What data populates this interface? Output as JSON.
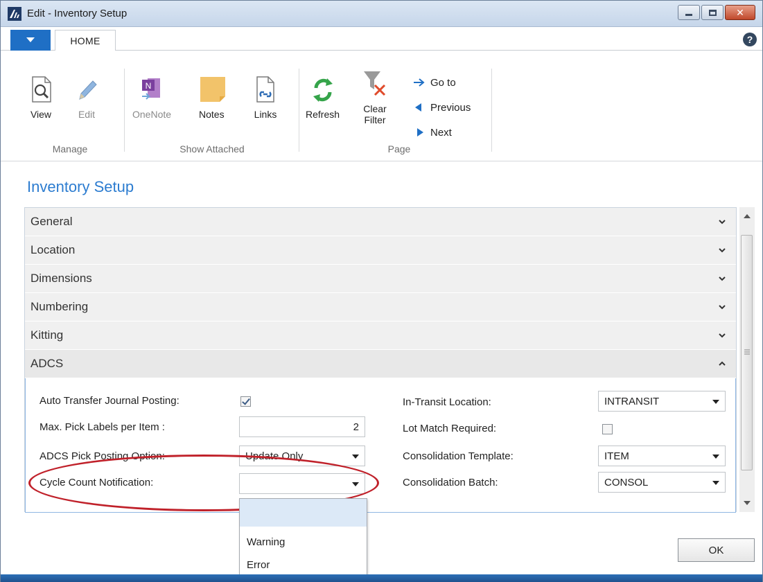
{
  "window": {
    "title": "Edit - Inventory Setup",
    "logo": "🗲"
  },
  "tabs": {
    "home": "HOME",
    "help": "?"
  },
  "ribbon": {
    "manage": {
      "name": "Manage",
      "view": "View",
      "edit": "Edit"
    },
    "show_attached": {
      "name": "Show Attached",
      "onenote": "OneNote",
      "notes": "Notes",
      "links": "Links"
    },
    "page": {
      "name": "Page",
      "refresh": "Refresh",
      "clear_filter_1": "Clear",
      "clear_filter_2": "Filter",
      "go_to": "Go to",
      "previous": "Previous",
      "next": "Next"
    }
  },
  "page_title": "Inventory Setup",
  "fasttabs": [
    "General",
    "Location",
    "Dimensions",
    "Numbering",
    "Kitting",
    "ADCS"
  ],
  "adcs": {
    "auto_transfer_label": "Auto Transfer Journal Posting:",
    "auto_transfer_checked": true,
    "max_pick_label": "Max. Pick Labels per Item :",
    "max_pick_value": "2",
    "pick_posting_label": "ADCS Pick Posting Option:",
    "pick_posting_value": "Update Only",
    "cycle_count_label": "Cycle Count Notification:",
    "cycle_count_value": "",
    "in_transit_label": "In-Transit Location:",
    "in_transit_value": "INTRANSIT",
    "lot_match_label": "Lot Match Required:",
    "lot_match_checked": false,
    "cons_template_label": "Consolidation Template:",
    "cons_template_value": "ITEM",
    "cons_batch_label": "Consolidation Batch:",
    "cons_batch_value": "CONSOL"
  },
  "dropdown": {
    "options": [
      "",
      "Warning",
      "Error"
    ]
  },
  "ok_label": "OK",
  "colors": {
    "accent": "#2c7cd0",
    "highlight": "#c0212a"
  }
}
